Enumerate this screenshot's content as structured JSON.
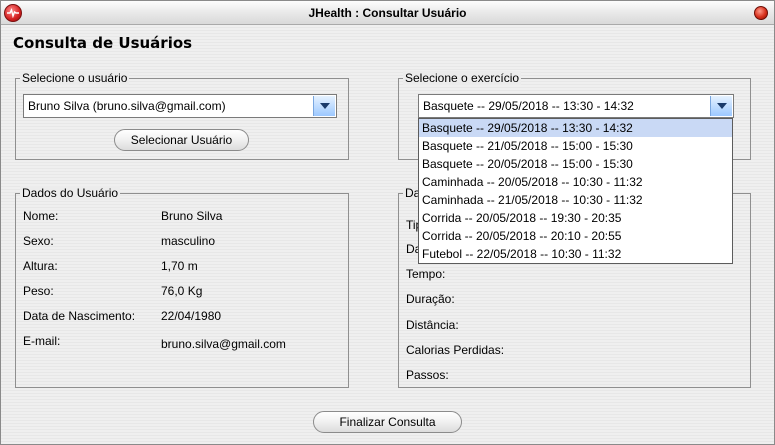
{
  "window": {
    "title": "JHealth : Consultar Usuário"
  },
  "page": {
    "title": "Consulta de Usuários"
  },
  "user_group": {
    "legend": "Selecione o usuário",
    "selected_user": "Bruno Silva (bruno.silva@gmail.com)",
    "select_button": "Selecionar Usuário"
  },
  "exercise_group": {
    "legend": "Selecione o exercício",
    "selected_exercise": "Basquete -- 29/05/2018 -- 13:30 - 14:32",
    "options": [
      "Basquete -- 29/05/2018 -- 13:30 - 14:32",
      "Basquete -- 21/05/2018 -- 15:00 - 15:30",
      "Basquete -- 20/05/2018 -- 15:00 - 15:30",
      "Caminhada -- 20/05/2018 -- 10:30 - 11:32",
      "Caminhada -- 21/05/2018 -- 10:30 - 11:32",
      "Corrida -- 20/05/2018 -- 19:30 - 20:35",
      "Corrida -- 20/05/2018 -- 20:10 - 20:55",
      "Futebol -- 22/05/2018 -- 10:30 - 11:32"
    ]
  },
  "user_data": {
    "legend": "Dados do Usuário",
    "rows": [
      {
        "label": "Nome:",
        "value": "Bruno Silva"
      },
      {
        "label": "Sexo:",
        "value": "masculino"
      },
      {
        "label": "Altura:",
        "value": "1,70 m"
      },
      {
        "label": "Peso:",
        "value": "76,0 Kg"
      },
      {
        "label": "Data de Nascimento:",
        "value": "22/04/1980"
      },
      {
        "label": "E-mail:",
        "value": "bruno.silva@gmail.com"
      }
    ]
  },
  "exercise_data": {
    "legend_partial": "Da",
    "row_partials": [
      "Tip",
      "Da"
    ],
    "rows": [
      {
        "label": "Tempo:"
      },
      {
        "label": "Duração:"
      },
      {
        "label": "Distância:"
      },
      {
        "label": "Calorias Perdidas:"
      },
      {
        "label": "Passos:"
      }
    ]
  },
  "footer": {
    "finish_button": "Finalizar Consulta"
  },
  "colors": {
    "selection": "#c9d9f5",
    "combo_arrow": "#9cc8ff",
    "close": "#d7301c"
  },
  "icons": [
    "heart-pulse-icon",
    "close-icon",
    "chevron-down-icon"
  ]
}
